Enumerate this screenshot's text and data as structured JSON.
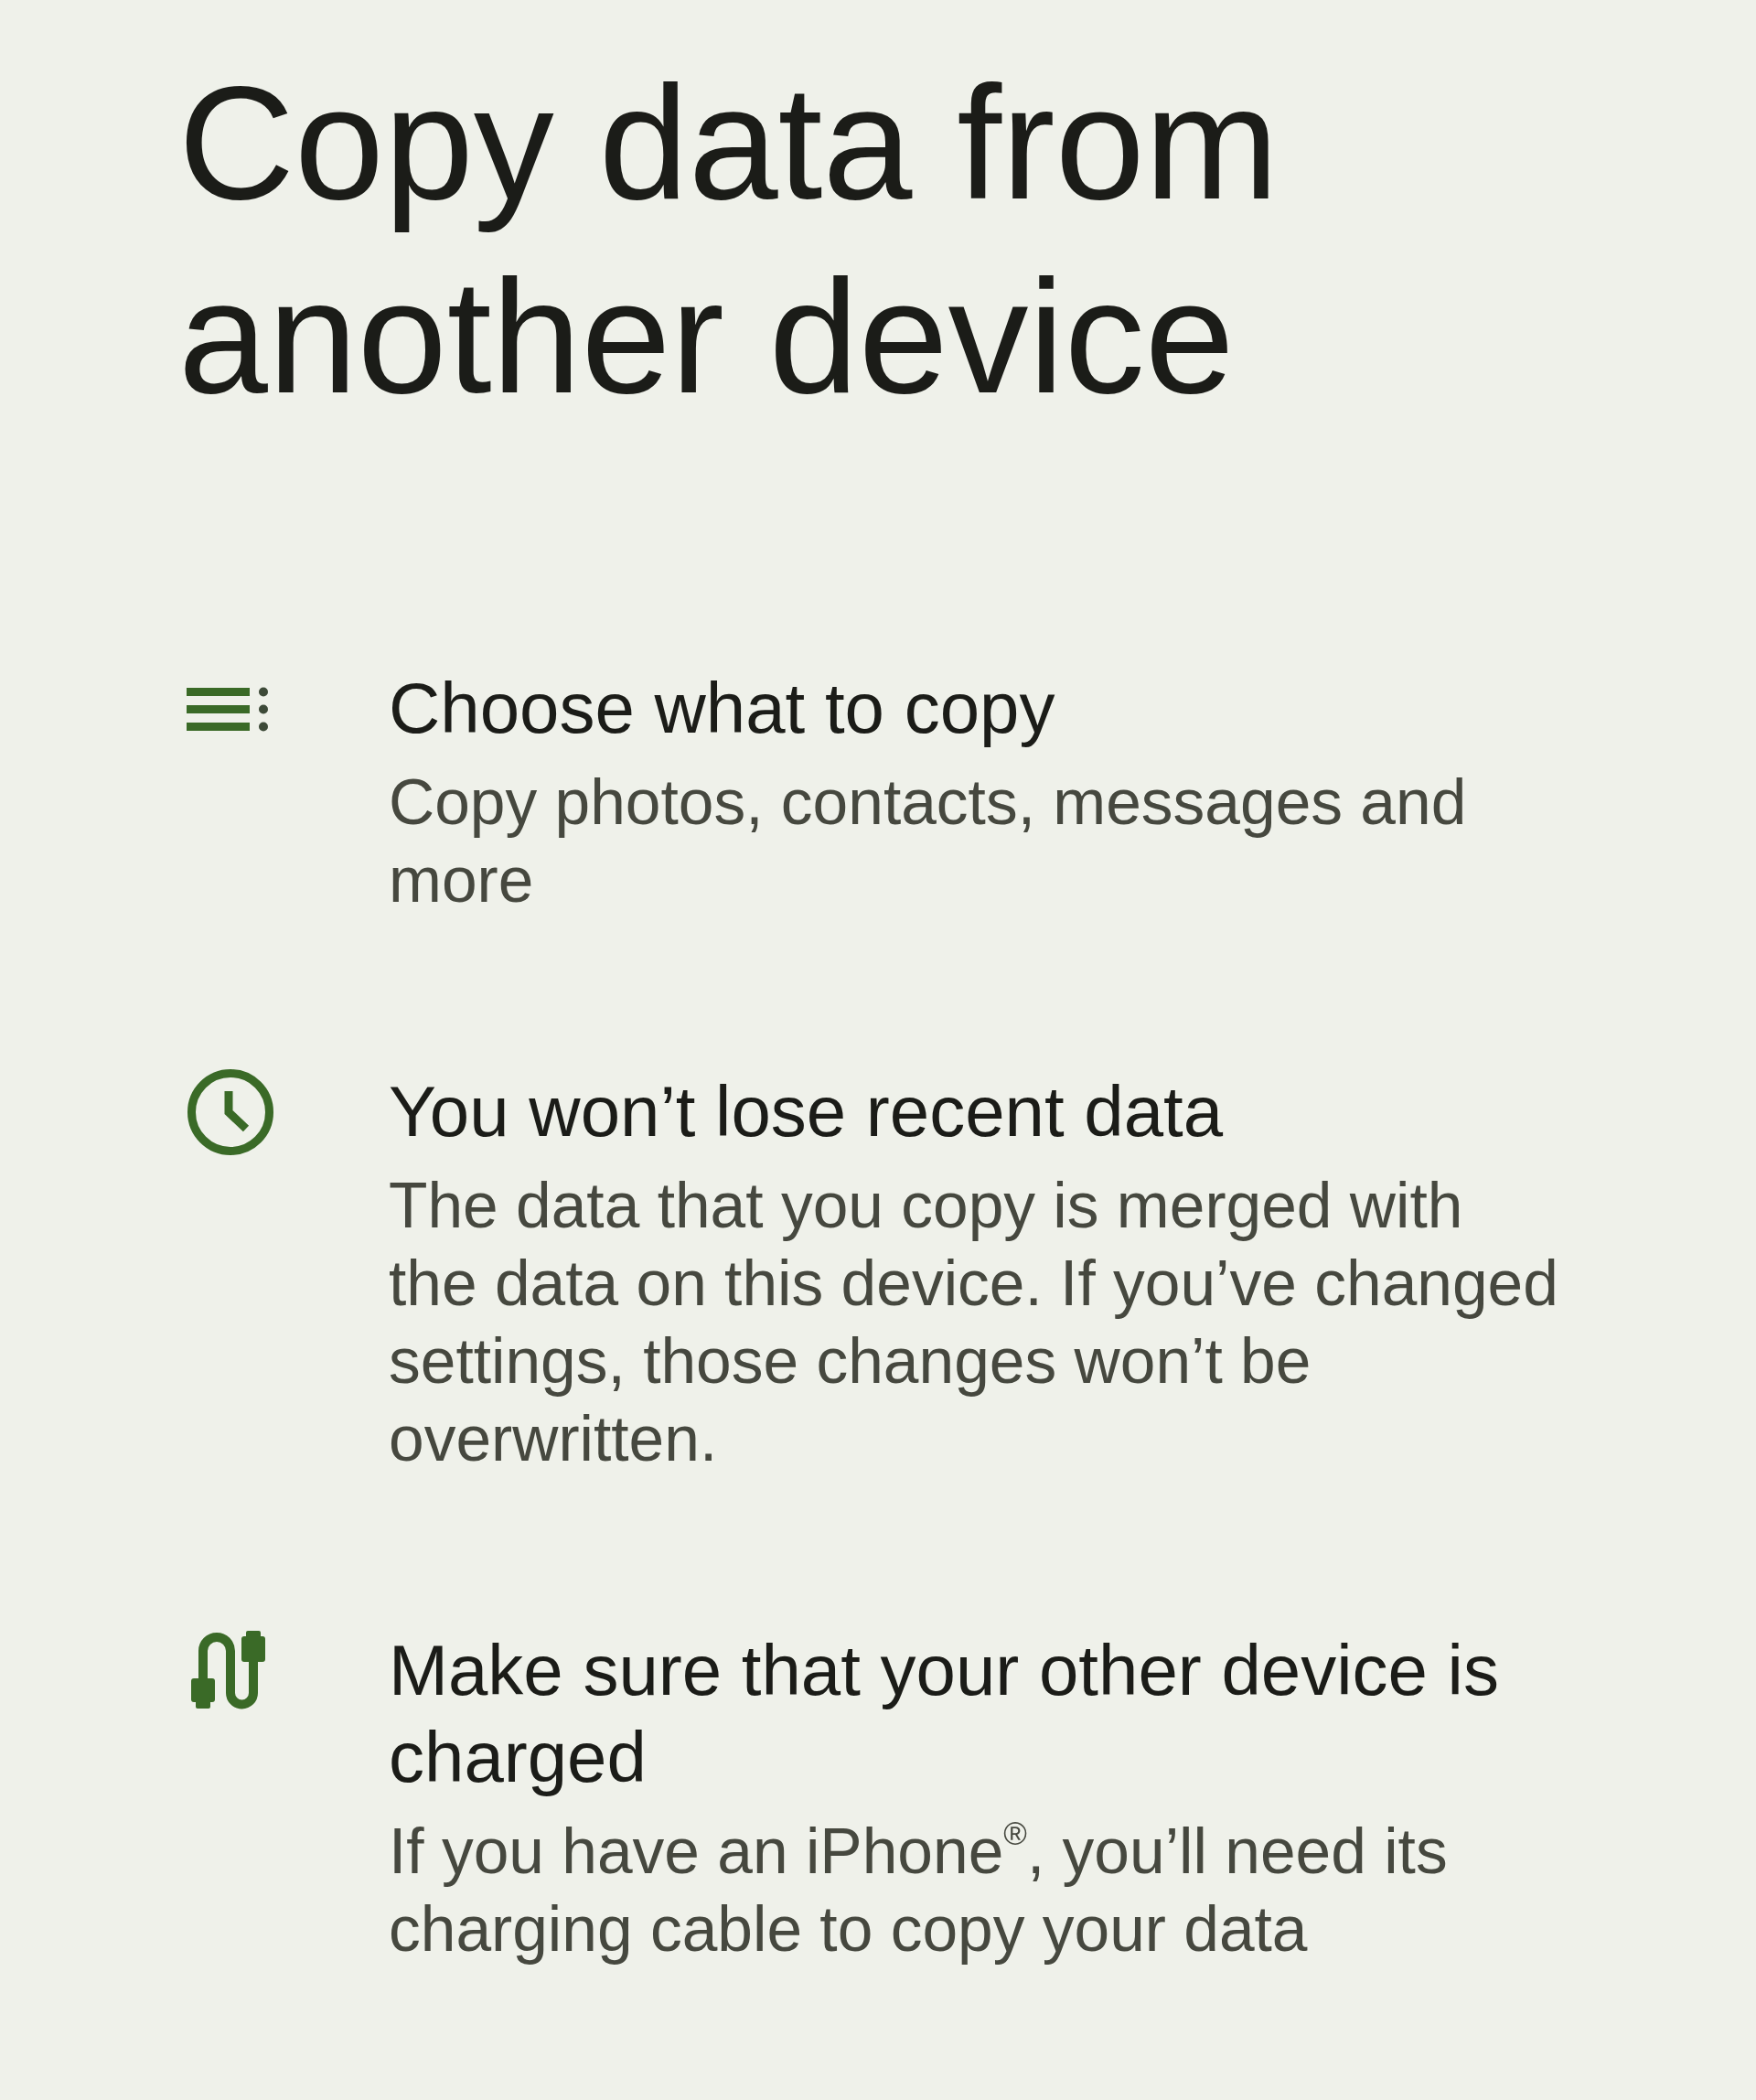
{
  "title": "Copy data from another device",
  "items": [
    {
      "kind": "list",
      "heading": "Choose what to copy",
      "body": "Copy photos, contacts, messages and more"
    },
    {
      "kind": "clock",
      "heading": "You won’t lose recent data",
      "body": "The data that you copy is merged with the data on this device. If you’ve changed settings, those changes won’t be overwritten."
    },
    {
      "kind": "cable",
      "heading": "Make sure that your other device is charged",
      "body": "If you have an iPhone$^{®}$, you’ll need its charging cable to copy your data"
    }
  ]
}
